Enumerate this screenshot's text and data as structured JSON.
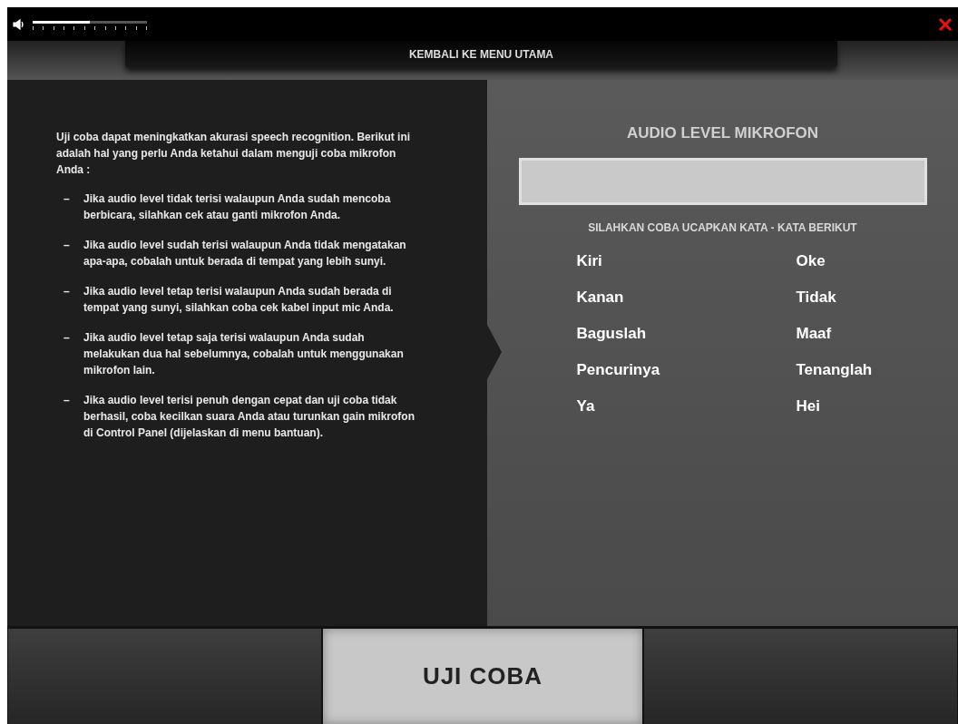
{
  "volume": {
    "level": 0.5
  },
  "back_button": "KEMBALI KE MENU UTAMA",
  "instructions": {
    "intro": "Uji coba dapat meningkatkan akurasi speech recognition. Berikut ini adalah hal yang perlu Anda ketahui dalam menguji coba mikrofon Anda :",
    "bullet": "–",
    "items": [
      "Jika audio level tidak terisi walaupun Anda sudah mencoba berbicara, silahkan cek atau ganti mikrofon Anda.",
      "Jika audio level sudah terisi walaupun Anda tidak mengatakan apa-apa, cobalah untuk berada di tempat yang lebih sunyi.",
      "Jika audio level tetap terisi walaupun Anda sudah berada di tempat yang sunyi, silahkan coba cek kabel input mic Anda.",
      "Jika audio level tetap saja terisi walaupun Anda sudah melakukan dua hal sebelumnya, cobalah untuk menggunakan mikrofon lain.",
      "Jika audio level terisi penuh dengan cepat dan uji coba tidak berhasil, coba kecilkan suara Anda atau turunkan gain mikrofon di Control Panel (dijelaskan di menu bantuan)."
    ]
  },
  "meter": {
    "title": "AUDIO LEVEL MIKROFON",
    "level": 0,
    "prompt": "SILAHKAN COBA UCAPKAN KATA - KATA BERIKUT"
  },
  "words": [
    "Kiri",
    "Oke",
    "Kanan",
    "Tidak",
    "Baguslah",
    "Maaf",
    "Pencurinya",
    "Tenanglah",
    "Ya",
    "Hei"
  ],
  "bottom_buttons": [
    {
      "selected": false
    },
    {
      "label": "UJI COBA",
      "selected": true
    },
    {
      "selected": false
    }
  ]
}
